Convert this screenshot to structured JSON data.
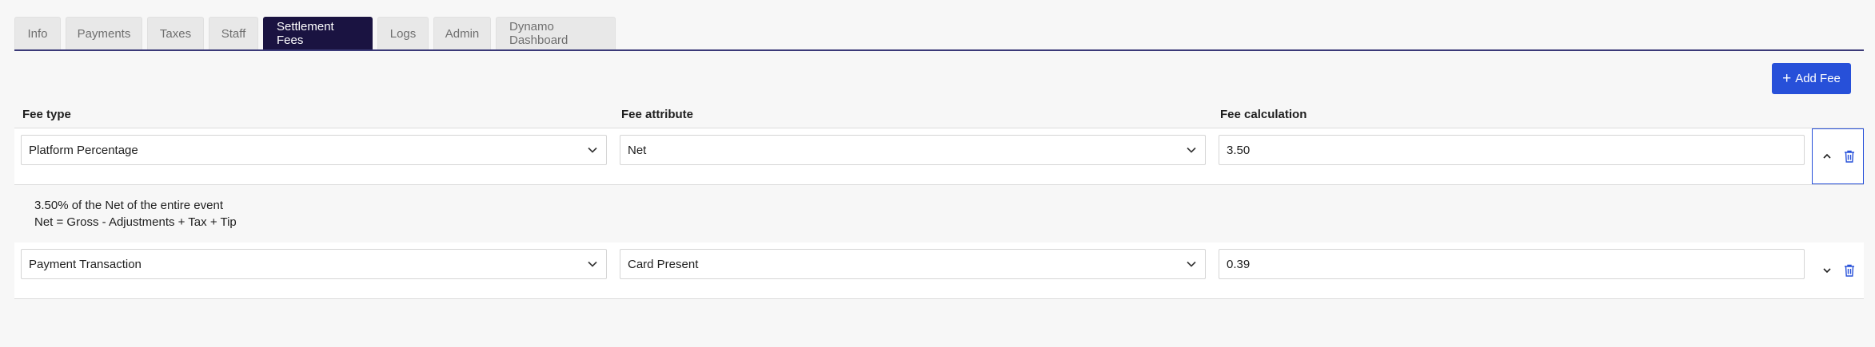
{
  "tabs": [
    {
      "label": "Info",
      "active": false
    },
    {
      "label": "Payments",
      "active": false
    },
    {
      "label": "Taxes",
      "active": false
    },
    {
      "label": "Staff",
      "active": false
    },
    {
      "label": "Settlement Fees",
      "active": true
    },
    {
      "label": "Logs",
      "active": false
    },
    {
      "label": "Admin",
      "active": false
    },
    {
      "label": "Dynamo Dashboard",
      "active": false
    }
  ],
  "toolbar": {
    "add_fee_label": "Add Fee",
    "add_fee_icon": "plus-icon"
  },
  "table": {
    "headers": {
      "fee_type": "Fee type",
      "fee_attribute": "Fee attribute",
      "fee_calculation": "Fee calculation"
    },
    "rows": [
      {
        "fee_type": "Platform Percentage",
        "fee_attribute": "Net",
        "fee_calculation": "3.50",
        "expanded": true,
        "details": [
          "3.50% of the Net of the entire event",
          "Net = Gross - Adjustments + Tax + Tip"
        ]
      },
      {
        "fee_type": "Payment Transaction",
        "fee_attribute": "Card Present",
        "fee_calculation": "0.39",
        "expanded": false
      }
    ]
  },
  "colors": {
    "active_tab": "#1a1341",
    "primary_button": "#2750d9",
    "delete_icon": "#2750d9",
    "selected_outline": "#2750d9"
  }
}
